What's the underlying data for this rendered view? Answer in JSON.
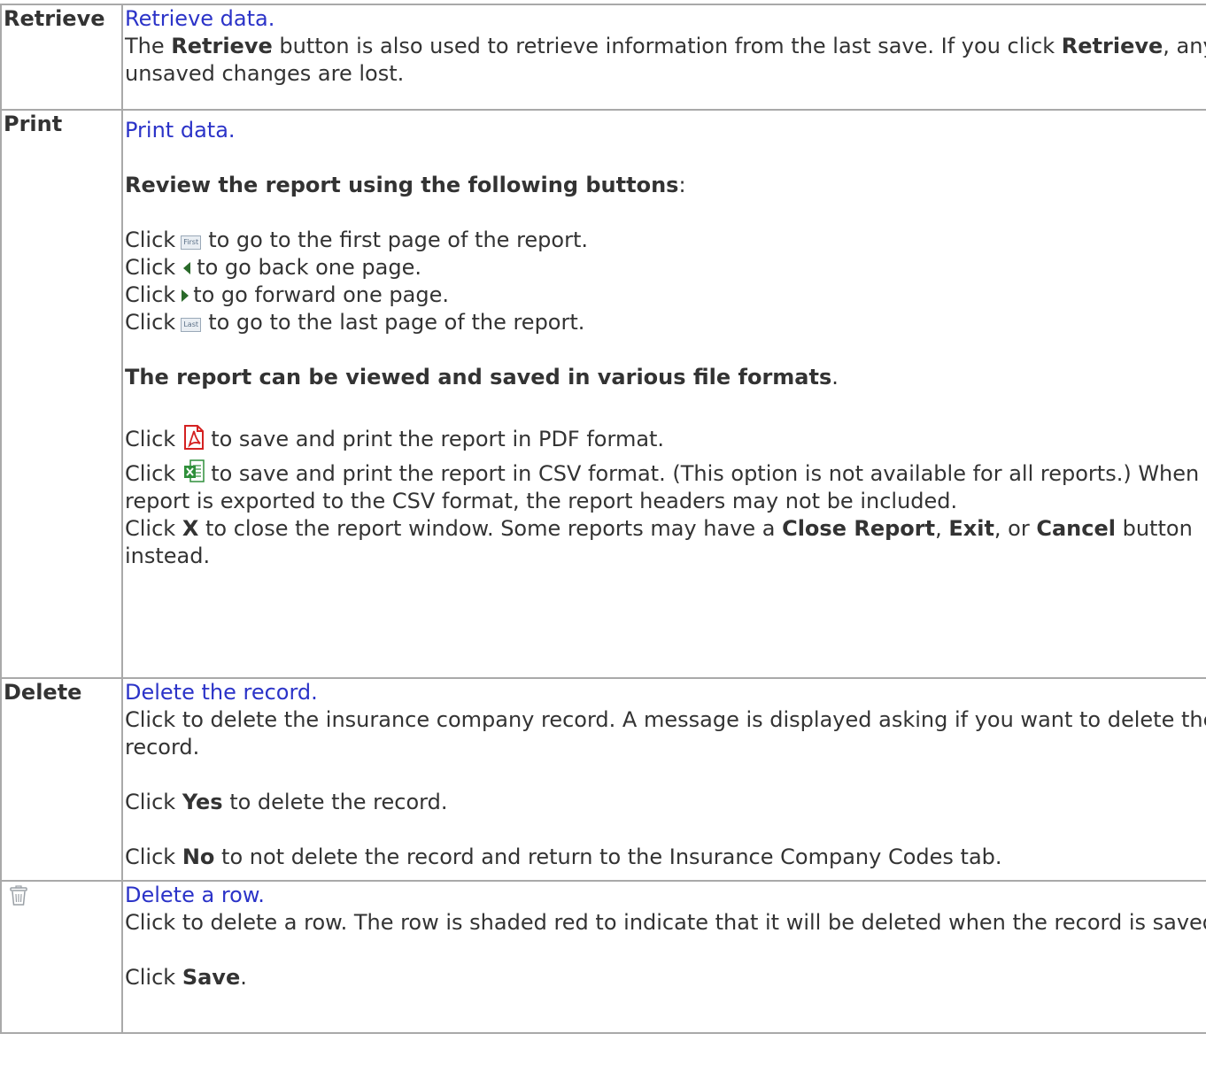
{
  "rows": [
    {
      "button": "Retrieve",
      "link": "Retrieve data.",
      "text": {
        "p1": "The ",
        "b1": "Retrieve",
        "p2": " button is also used to retrieve information from the last save. If you click ",
        "b2": "Retrieve",
        "p3": ", any unsaved changes are lost."
      }
    },
    {
      "button": "Print",
      "link": "Print data.",
      "review_heading": "Review the report using the following buttons",
      "review_colon": ":",
      "click": "Click",
      "first_icon_text": "First",
      "first_text": "to go to the first page of the report.",
      "back_text": "to go back one page.",
      "forward_text": "to go forward one page.",
      "last_icon_text": "Last",
      "last_text": "to go to the last page of the report.",
      "formats_heading": "The report can be viewed and saved in various file formats",
      "formats_period": ".",
      "pdf_text": "to save and print the report in PDF format.",
      "csv_text": "to save and print the report in CSV format. (This option is not available for all reports.) When a report is exported to the CSV format, the report headers may not be included.",
      "close": {
        "p1": "Click ",
        "b1": "X",
        "p2": " to close the report window. Some reports may have a ",
        "b2": "Close Report",
        "p3": ", ",
        "b3": "Exit",
        "p4": ", or ",
        "b4": "Cancel",
        "p5": " button instead."
      }
    },
    {
      "button": "Delete",
      "link": "Delete the record.",
      "text": "Click to delete the insurance company record. A message is displayed asking if you want to delete the record.",
      "yes": {
        "p1": "Click ",
        "b1": "Yes",
        "p2": " to delete the record."
      },
      "no": {
        "p1": "Click ",
        "b1": "No",
        "p2": " to not delete the record and return to the Insurance Company Codes tab."
      }
    },
    {
      "icon": "trash-icon",
      "link": "Delete a row.",
      "text": "Click to delete a row. The row is shaded red to indicate that it will be deleted when the record is saved.",
      "save": {
        "p1": "Click ",
        "b1": "Save",
        "p2": "."
      }
    }
  ],
  "colors": {
    "link": "#2b33c8",
    "border": "#a9a9a9",
    "text": "#333333",
    "pdf_red": "#d42121",
    "csv_green": "#2f8f3a",
    "nav_arrow": "#2a6a2a"
  }
}
